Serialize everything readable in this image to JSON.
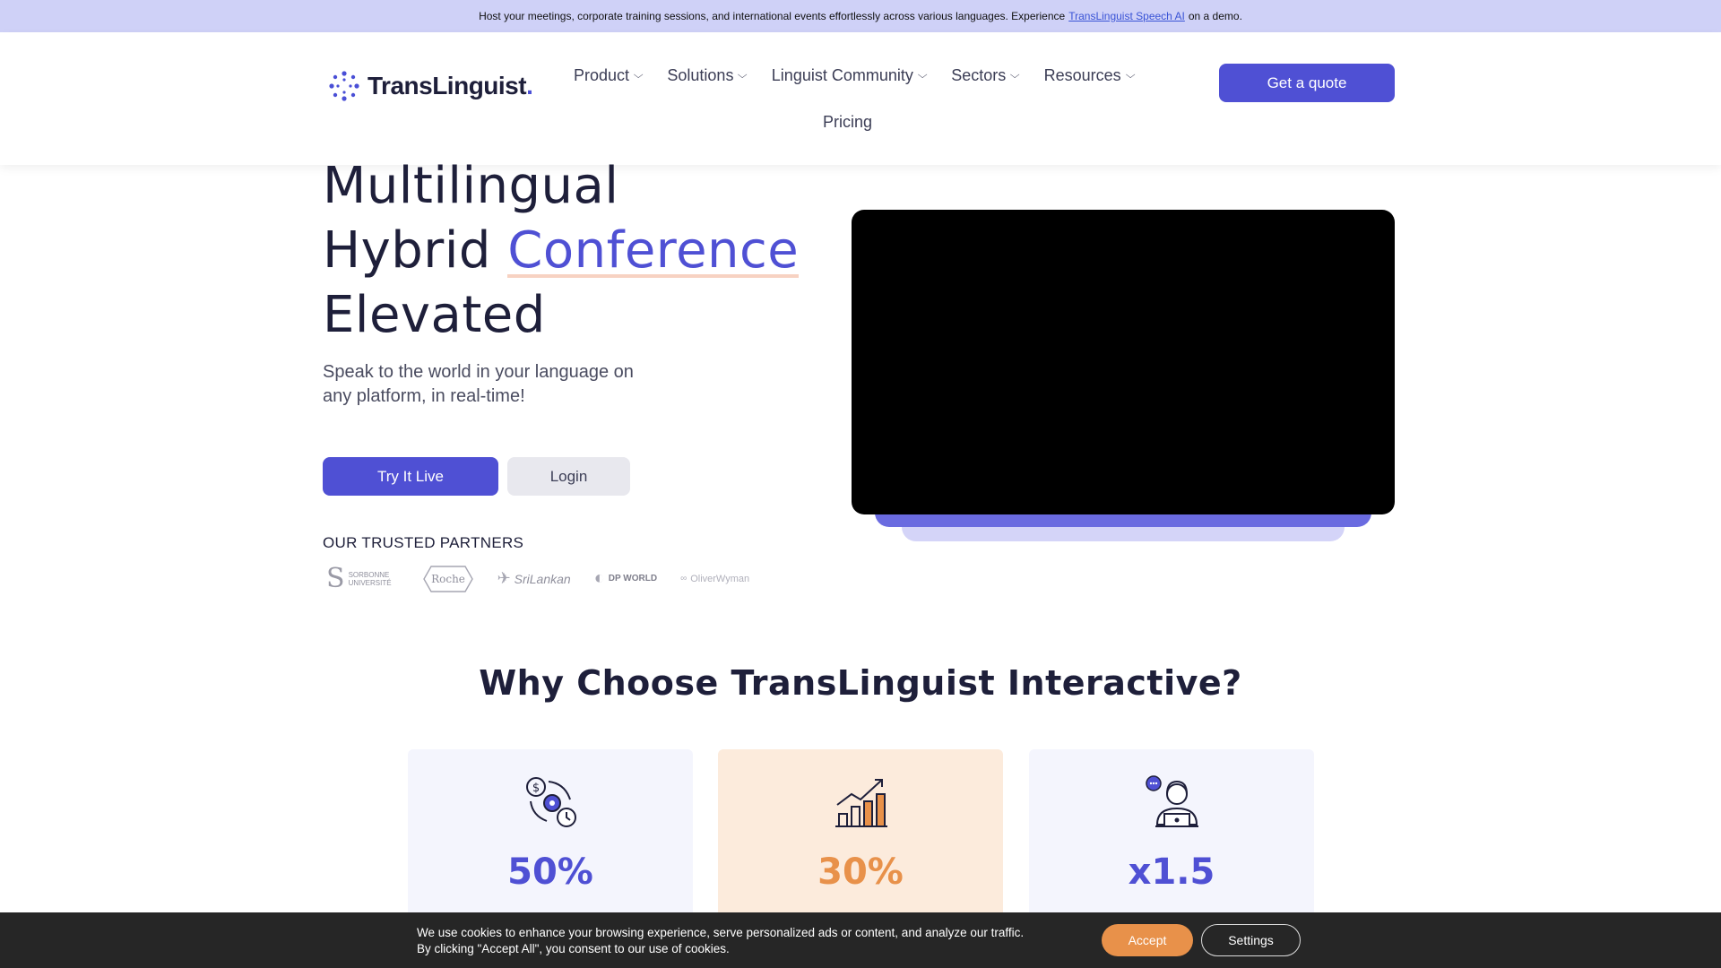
{
  "announcement": {
    "text_before": "Host your meetings, corporate training sessions, and international events effortlessly across various languages. Experience",
    "link": "TransLinguist Speech AI",
    "text_after": "on a demo."
  },
  "logo": {
    "text": "TransLinguist",
    "dot": "."
  },
  "nav": {
    "items": [
      {
        "label": "Product"
      },
      {
        "label": "Solutions"
      },
      {
        "label": "Linguist Community"
      },
      {
        "label": "Sectors"
      },
      {
        "label": "Resources"
      }
    ],
    "pricing": "Pricing",
    "cta": "Get a quote"
  },
  "hero": {
    "title_line1": "Multilingual",
    "title_line2_plain": "Hybrid",
    "title_line2_accent": "Conference",
    "title_line3": "Elevated",
    "subtitle": "Speak to the world in your language on any platform, in real-time!",
    "primary_button": "Try It Live",
    "secondary_button": "Login"
  },
  "partners": {
    "title": "OUR TRUSTED PARTNERS",
    "logos": [
      "SORBONNE UNIVERSITÉ",
      "Roche",
      "SriLankan",
      "DP WORLD",
      "OliverWyman"
    ]
  },
  "why": {
    "title": "Why Choose TransLinguist Interactive?",
    "cards": [
      {
        "value": "50%",
        "icon": "cost-savings-icon"
      },
      {
        "value": "30%",
        "icon": "growth-chart-icon"
      },
      {
        "value": "x1.5",
        "icon": "support-agent-icon"
      }
    ]
  },
  "cookie": {
    "line1": "We use cookies to enhance your browsing experience, serve personalized ads or content, and analyze our traffic.",
    "line2": "By clicking \"Accept All\", you consent to our use of cookies.",
    "accept": "Accept",
    "settings": "Settings"
  },
  "colors": {
    "brand": "#4f50d4",
    "accent_orange": "#e8914a",
    "announcement_bg": "#cfd1f7"
  }
}
